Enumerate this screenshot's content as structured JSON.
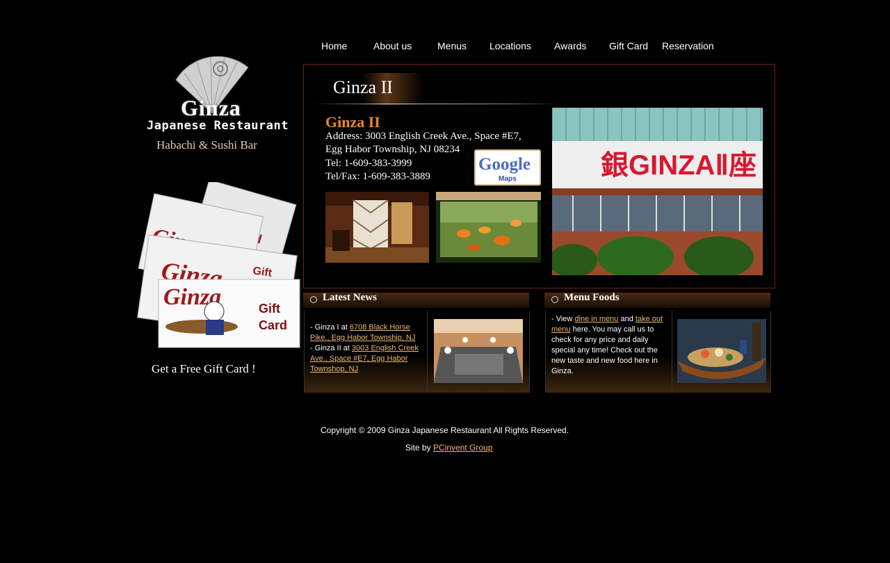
{
  "nav": {
    "items": [
      "Home",
      "About us",
      "Menus",
      "Locations",
      "Awards",
      "Gift Card",
      "Reservation"
    ]
  },
  "logo": {
    "title": "Ginza",
    "subtitle": "Japanese Restaurant",
    "tagline": "Habachi & Sushi Bar"
  },
  "gift": {
    "free_text": "Get a Free Gift Card !"
  },
  "location": {
    "header": "Ginza II",
    "name": "Ginza II",
    "address1": "Address: 3003 English Creek Ave., Space #E7,",
    "address2": "Egg Habor Township, NJ 08234",
    "tel": "Tel: 1-609-383-3999",
    "fax": "Tel/Fax: 1-609-383-3889",
    "map_button": {
      "brand": "Google",
      "sub": "Maps"
    }
  },
  "news": {
    "title": "Latest News",
    "item1_prefix": "- Ginza I at ",
    "item1_link": "6708 Black Horse Pike., Egg Habor Township, NJ",
    "item2_prefix": "- Ginza II at ",
    "item2_link": "3003 English Creek Ave., Space #E7, Egg Habor Townshop, NJ"
  },
  "menu_foods": {
    "title": "Menu Foods",
    "prefix": "- View ",
    "link1": "dine in menu",
    "middle": " and ",
    "link2": "take out menu",
    "suffix": " here. You may call us to check for any price and daily special any time! Check out the new taste and new food here in Ginza."
  },
  "footer": {
    "copyright": "Copyright © 2009 Ginza Japanese Restaurant  All Rights Reserved.",
    "site_by": "Site by ",
    "site_link": "PCinvent Group"
  }
}
